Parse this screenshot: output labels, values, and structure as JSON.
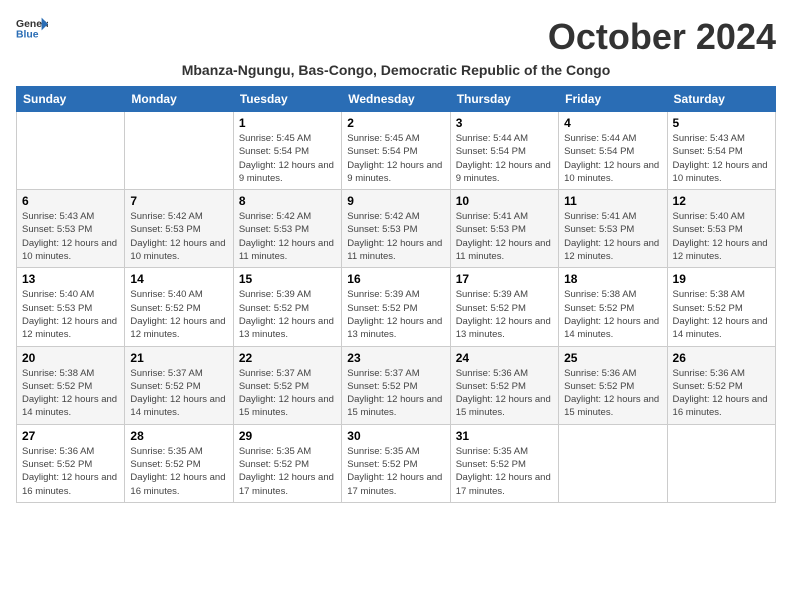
{
  "header": {
    "logo_line1": "General",
    "logo_line2": "Blue",
    "month_title": "October 2024",
    "subtitle": "Mbanza-Ngungu, Bas-Congo, Democratic Republic of the Congo"
  },
  "weekdays": [
    "Sunday",
    "Monday",
    "Tuesday",
    "Wednesday",
    "Thursday",
    "Friday",
    "Saturday"
  ],
  "weeks": [
    [
      {
        "day": "",
        "info": ""
      },
      {
        "day": "",
        "info": ""
      },
      {
        "day": "1",
        "info": "Sunrise: 5:45 AM\nSunset: 5:54 PM\nDaylight: 12 hours and 9 minutes."
      },
      {
        "day": "2",
        "info": "Sunrise: 5:45 AM\nSunset: 5:54 PM\nDaylight: 12 hours and 9 minutes."
      },
      {
        "day": "3",
        "info": "Sunrise: 5:44 AM\nSunset: 5:54 PM\nDaylight: 12 hours and 9 minutes."
      },
      {
        "day": "4",
        "info": "Sunrise: 5:44 AM\nSunset: 5:54 PM\nDaylight: 12 hours and 10 minutes."
      },
      {
        "day": "5",
        "info": "Sunrise: 5:43 AM\nSunset: 5:54 PM\nDaylight: 12 hours and 10 minutes."
      }
    ],
    [
      {
        "day": "6",
        "info": "Sunrise: 5:43 AM\nSunset: 5:53 PM\nDaylight: 12 hours and 10 minutes."
      },
      {
        "day": "7",
        "info": "Sunrise: 5:42 AM\nSunset: 5:53 PM\nDaylight: 12 hours and 10 minutes."
      },
      {
        "day": "8",
        "info": "Sunrise: 5:42 AM\nSunset: 5:53 PM\nDaylight: 12 hours and 11 minutes."
      },
      {
        "day": "9",
        "info": "Sunrise: 5:42 AM\nSunset: 5:53 PM\nDaylight: 12 hours and 11 minutes."
      },
      {
        "day": "10",
        "info": "Sunrise: 5:41 AM\nSunset: 5:53 PM\nDaylight: 12 hours and 11 minutes."
      },
      {
        "day": "11",
        "info": "Sunrise: 5:41 AM\nSunset: 5:53 PM\nDaylight: 12 hours and 12 minutes."
      },
      {
        "day": "12",
        "info": "Sunrise: 5:40 AM\nSunset: 5:53 PM\nDaylight: 12 hours and 12 minutes."
      }
    ],
    [
      {
        "day": "13",
        "info": "Sunrise: 5:40 AM\nSunset: 5:53 PM\nDaylight: 12 hours and 12 minutes."
      },
      {
        "day": "14",
        "info": "Sunrise: 5:40 AM\nSunset: 5:52 PM\nDaylight: 12 hours and 12 minutes."
      },
      {
        "day": "15",
        "info": "Sunrise: 5:39 AM\nSunset: 5:52 PM\nDaylight: 12 hours and 13 minutes."
      },
      {
        "day": "16",
        "info": "Sunrise: 5:39 AM\nSunset: 5:52 PM\nDaylight: 12 hours and 13 minutes."
      },
      {
        "day": "17",
        "info": "Sunrise: 5:39 AM\nSunset: 5:52 PM\nDaylight: 12 hours and 13 minutes."
      },
      {
        "day": "18",
        "info": "Sunrise: 5:38 AM\nSunset: 5:52 PM\nDaylight: 12 hours and 14 minutes."
      },
      {
        "day": "19",
        "info": "Sunrise: 5:38 AM\nSunset: 5:52 PM\nDaylight: 12 hours and 14 minutes."
      }
    ],
    [
      {
        "day": "20",
        "info": "Sunrise: 5:38 AM\nSunset: 5:52 PM\nDaylight: 12 hours and 14 minutes."
      },
      {
        "day": "21",
        "info": "Sunrise: 5:37 AM\nSunset: 5:52 PM\nDaylight: 12 hours and 14 minutes."
      },
      {
        "day": "22",
        "info": "Sunrise: 5:37 AM\nSunset: 5:52 PM\nDaylight: 12 hours and 15 minutes."
      },
      {
        "day": "23",
        "info": "Sunrise: 5:37 AM\nSunset: 5:52 PM\nDaylight: 12 hours and 15 minutes."
      },
      {
        "day": "24",
        "info": "Sunrise: 5:36 AM\nSunset: 5:52 PM\nDaylight: 12 hours and 15 minutes."
      },
      {
        "day": "25",
        "info": "Sunrise: 5:36 AM\nSunset: 5:52 PM\nDaylight: 12 hours and 15 minutes."
      },
      {
        "day": "26",
        "info": "Sunrise: 5:36 AM\nSunset: 5:52 PM\nDaylight: 12 hours and 16 minutes."
      }
    ],
    [
      {
        "day": "27",
        "info": "Sunrise: 5:36 AM\nSunset: 5:52 PM\nDaylight: 12 hours and 16 minutes."
      },
      {
        "day": "28",
        "info": "Sunrise: 5:35 AM\nSunset: 5:52 PM\nDaylight: 12 hours and 16 minutes."
      },
      {
        "day": "29",
        "info": "Sunrise: 5:35 AM\nSunset: 5:52 PM\nDaylight: 12 hours and 17 minutes."
      },
      {
        "day": "30",
        "info": "Sunrise: 5:35 AM\nSunset: 5:52 PM\nDaylight: 12 hours and 17 minutes."
      },
      {
        "day": "31",
        "info": "Sunrise: 5:35 AM\nSunset: 5:52 PM\nDaylight: 12 hours and 17 minutes."
      },
      {
        "day": "",
        "info": ""
      },
      {
        "day": "",
        "info": ""
      }
    ]
  ]
}
